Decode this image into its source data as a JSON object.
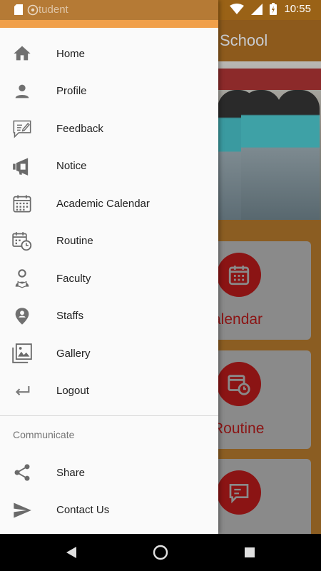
{
  "status_bar": {
    "time": "10:55",
    "left_overlay_text": "tudent"
  },
  "background_app": {
    "title": "School",
    "cards": [
      {
        "label": "alendar",
        "icon": "calendar-icon"
      },
      {
        "label": "Routine",
        "icon": "routine-icon"
      },
      {
        "label": "",
        "icon": "feedback-icon"
      }
    ]
  },
  "drawer": {
    "menu": [
      {
        "label": "Home",
        "icon": "home-icon"
      },
      {
        "label": "Profile",
        "icon": "person-icon"
      },
      {
        "label": "Feedback",
        "icon": "feedback-icon"
      },
      {
        "label": "Notice",
        "icon": "megaphone-icon"
      },
      {
        "label": "Academic Calendar",
        "icon": "calendar-icon"
      },
      {
        "label": "Routine",
        "icon": "routine-icon"
      },
      {
        "label": "Faculty",
        "icon": "faculty-icon"
      },
      {
        "label": "Staffs",
        "icon": "staff-icon"
      },
      {
        "label": "Gallery",
        "icon": "gallery-icon"
      },
      {
        "label": "Logout",
        "icon": "logout-icon"
      }
    ],
    "section_title": "Communicate",
    "communicate": [
      {
        "label": "Share",
        "icon": "share-icon"
      },
      {
        "label": "Contact Us",
        "icon": "send-icon"
      }
    ]
  },
  "colors": {
    "drawer_bg": "#fafafa",
    "header_accent": "#f0a04a",
    "icon_gray": "#6d6d6d",
    "card_red": "#c62828"
  }
}
